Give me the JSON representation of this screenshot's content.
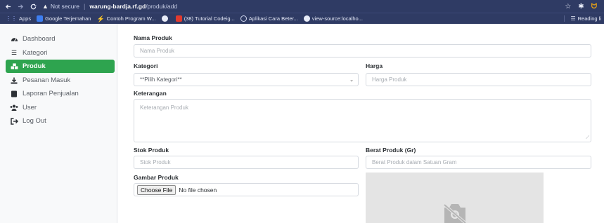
{
  "browser": {
    "back_icon": "arrow-left-icon",
    "forward_icon": "arrow-right-icon",
    "reload_icon": "reload-icon",
    "security_label": "Not secure",
    "url_host": "warung-bardja.rf.gd",
    "url_path": "/produk/add",
    "bookmarks": [
      {
        "label": "Apps",
        "icon": "apps-grid-icon"
      },
      {
        "label": "Google Terjemahan",
        "icon": "google-translate-icon"
      },
      {
        "label": "Contoh Program W...",
        "icon": "bolt-icon"
      },
      {
        "label": "",
        "icon": "github-icon"
      },
      {
        "label": "(38) Tutorial Codeig...",
        "icon": "youtube-icon"
      },
      {
        "label": "Aplikasi Cara Beter...",
        "icon": "ring-icon"
      },
      {
        "label": "view-source:localho...",
        "icon": "globe-icon"
      }
    ],
    "reading_list_label": "Reading li"
  },
  "sidebar": {
    "items": [
      {
        "label": "Dashboard",
        "icon": "dashboard-gauge-icon",
        "active": false
      },
      {
        "label": "Kategori",
        "icon": "list-icon",
        "active": false
      },
      {
        "label": "Produk",
        "icon": "cubes-icon",
        "active": true
      },
      {
        "label": "Pesanan Masuk",
        "icon": "download-icon",
        "active": false
      },
      {
        "label": "Laporan Penjualan",
        "icon": "book-icon",
        "active": false
      },
      {
        "label": "User",
        "icon": "users-icon",
        "active": false
      },
      {
        "label": "Log Out",
        "icon": "sign-out-icon",
        "active": false
      }
    ],
    "active_color": "#2ea44f"
  },
  "form": {
    "nama_label": "Nama Produk",
    "nama_placeholder": "Nama Produk",
    "kategori_label": "Kategori",
    "kategori_selected": "**Pilih Kategori**",
    "harga_label": "Harga",
    "harga_placeholder": "Harga Produk",
    "keterangan_label": "Keterangan",
    "keterangan_placeholder": "Keterangan Produk",
    "stok_label": "Stok Produk",
    "stok_placeholder": "Stok Produk",
    "berat_label": "Berat Produk (Gr)",
    "berat_placeholder": "Berat Produk dalam Satuan Gram",
    "gambar_label": "Gambar Produk",
    "choose_file_label": "Choose File",
    "no_file_label": "No file chosen",
    "preview_icon": "no-camera-icon"
  }
}
